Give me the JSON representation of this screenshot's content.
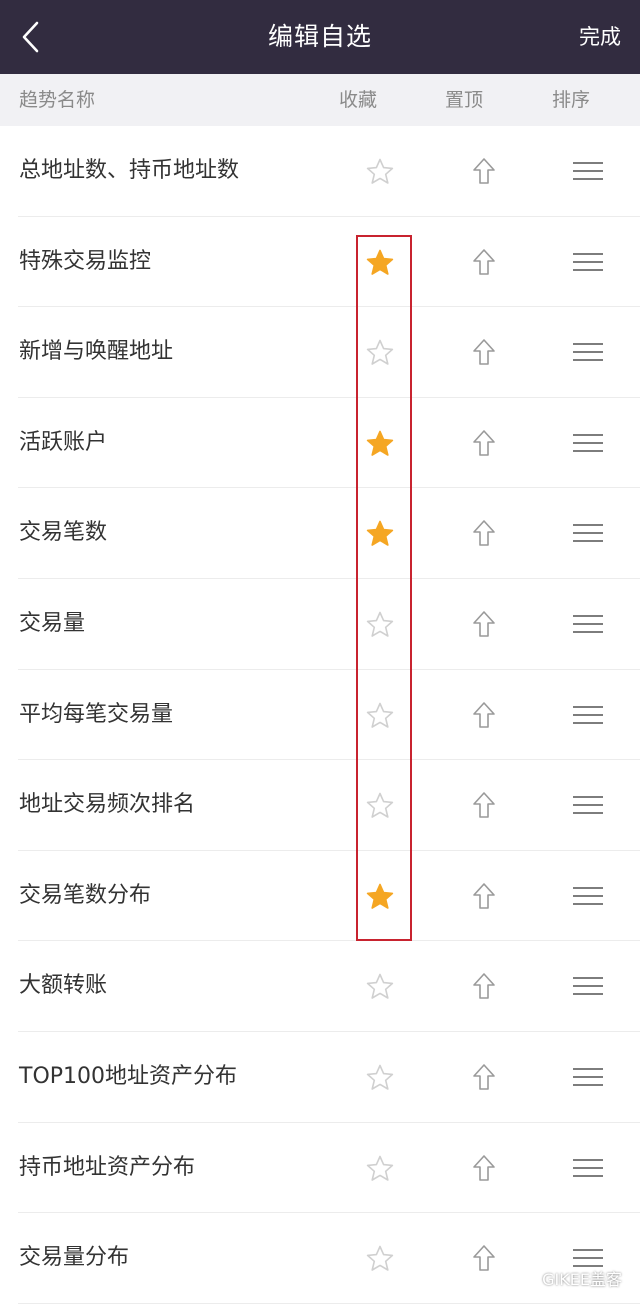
{
  "header": {
    "title": "编辑自选",
    "done_label": "完成"
  },
  "columns": {
    "name": "趋势名称",
    "favorite": "收藏",
    "pin": "置顶",
    "sort": "排序"
  },
  "rows": [
    {
      "label": "总地址数、持币地址数",
      "favorited": false
    },
    {
      "label": "特殊交易监控",
      "favorited": true
    },
    {
      "label": "新增与唤醒地址",
      "favorited": false
    },
    {
      "label": "活跃账户",
      "favorited": true
    },
    {
      "label": "交易笔数",
      "favorited": true
    },
    {
      "label": "交易量",
      "favorited": false
    },
    {
      "label": "平均每笔交易量",
      "favorited": false
    },
    {
      "label": "地址交易频次排名",
      "favorited": false
    },
    {
      "label": "交易笔数分布",
      "favorited": true
    },
    {
      "label": "大额转账",
      "favorited": false
    },
    {
      "label": "TOP100地址资产分布",
      "favorited": false
    },
    {
      "label": "持币地址资产分布",
      "favorited": false
    },
    {
      "label": "交易量分布",
      "favorited": false
    }
  ],
  "colors": {
    "navbar": "#322c40",
    "star_active": "#f5a623",
    "star_inactive": "#d0d0d0",
    "highlight": "#c8232f"
  },
  "icons": {
    "back": "chevron-left-icon",
    "favorite": "star-icon",
    "pin": "arrow-up-icon",
    "sort": "drag-handle-icon"
  },
  "watermark": "GIKEE盖客"
}
